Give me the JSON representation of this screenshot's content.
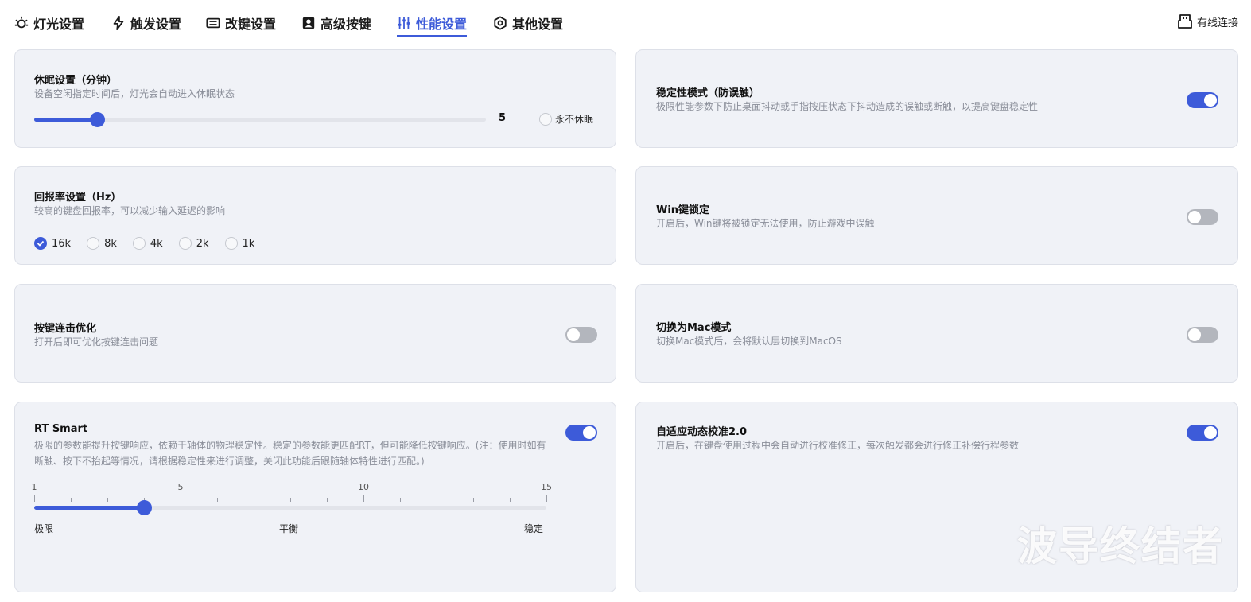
{
  "nav": {
    "tabs": [
      {
        "label": "灯光设置",
        "icon": "bulb-icon"
      },
      {
        "label": "触发设置",
        "icon": "lightning-icon"
      },
      {
        "label": "改键设置",
        "icon": "keyboard-icon"
      },
      {
        "label": "高级按键",
        "icon": "person-key-icon"
      },
      {
        "label": "性能设置",
        "icon": "sliders-icon"
      },
      {
        "label": "其他设置",
        "icon": "hexagon-settings-icon"
      }
    ],
    "active_tab": "性能设置",
    "connection": "有线连接"
  },
  "sleep": {
    "title": "休眠设置（分钟）",
    "desc": "设备空闲指定时间后，灯光会自动进入休眠状态",
    "value": "5",
    "slider_fraction": 0.139,
    "never_label": "永不休眠"
  },
  "report_rate": {
    "title": "回报率设置（Hz）",
    "desc": "较高的键盘回报率，可以减少输入延迟的影响",
    "options": [
      "16k",
      "8k",
      "4k",
      "2k",
      "1k"
    ],
    "selected": "16k"
  },
  "debounce": {
    "title": "按键连击优化",
    "desc": "打开后即可优化按键连击问题",
    "enabled": false
  },
  "rt_smart": {
    "title": "RT Smart",
    "desc": "极限的参数能提升按键响应，依赖于轴体的物理稳定性。稳定的参数能更匹配RT，但可能降低按键响应。(注：使用时如有断触、按下不抬起等情况，请根据稳定性来进行调整，关闭此功能后跟随轴体特性进行匹配。)",
    "enabled": true,
    "min": 1,
    "max": 15,
    "value": 4,
    "tick_labels": [
      "1",
      "5",
      "10",
      "15"
    ],
    "labels": {
      "left": "极限",
      "mid": "平衡",
      "right": "稳定"
    }
  },
  "stability": {
    "title": "稳定性模式（防误触）",
    "desc": "极限性能参数下防止桌面抖动或手指按压状态下抖动造成的误触或断触，以提高键盘稳定性",
    "enabled": true
  },
  "win_lock": {
    "title": "Win键锁定",
    "desc": "开启后，Win键将被锁定无法使用，防止游戏中误触",
    "enabled": false
  },
  "mac_mode": {
    "title": "切换为Mac模式",
    "desc": "切换Mac模式后，会将默认层切换到MacOS",
    "enabled": false
  },
  "adaptive": {
    "title": "自适应动态校准2.0",
    "desc": "开启后，在键盘使用过程中会自动进行校准修正，每次触发都会进行修正补偿行程参数",
    "enabled": true
  },
  "watermark": "波导终结者",
  "colors": {
    "accent": "#3d5bd9",
    "card": "#f0f2f7",
    "toggle_off": "#b3b6bd"
  }
}
